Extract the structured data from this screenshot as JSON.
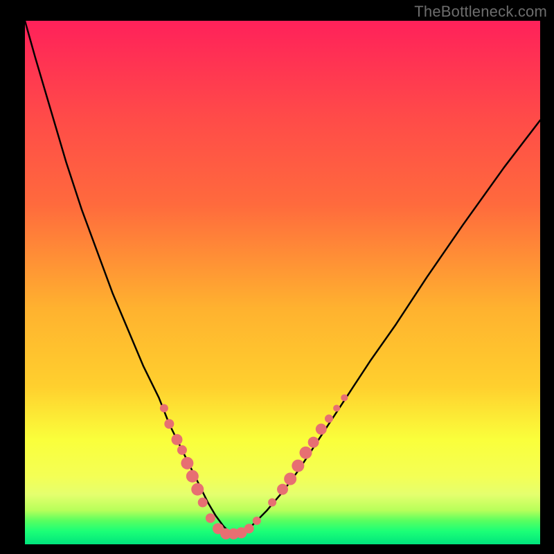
{
  "watermark": "TheBottleneck.com",
  "colors": {
    "background": "#000000",
    "gradient_top": "#ff215a",
    "gradient_upper": "#ff6a3d",
    "gradient_mid": "#ffd02e",
    "gradient_lower": "#faff3b",
    "gradient_band": "#e5ff6e",
    "gradient_bottom1": "#58ff60",
    "gradient_bottom2": "#00e57c",
    "curve": "#000000",
    "marker": "#e76f72",
    "watermark_color": "#6d6d6d"
  },
  "chart_data": {
    "type": "line",
    "title": "",
    "xlabel": "",
    "ylabel": "",
    "xlim": [
      0,
      100
    ],
    "ylim": [
      0,
      100
    ],
    "series": [
      {
        "name": "curve",
        "x": [
          0,
          2,
          5,
          8,
          11,
          14,
          17,
          20,
          23,
          26,
          28,
          30,
          32,
          34,
          35.5,
          37,
          38.5,
          40,
          42,
          44,
          47,
          50,
          53,
          56,
          59,
          63,
          67,
          72,
          78,
          85,
          93,
          100
        ],
        "y": [
          100,
          93,
          83,
          73,
          64,
          56,
          48,
          41,
          34,
          28,
          23,
          19,
          15,
          11,
          8,
          5.5,
          3.5,
          2,
          2,
          3.5,
          6.5,
          10,
          14,
          18.5,
          23,
          29,
          35,
          42,
          51,
          61,
          72,
          81
        ]
      }
    ],
    "markers": {
      "name": "highlighted-points",
      "points": [
        {
          "x": 27,
          "y": 26,
          "r": 6
        },
        {
          "x": 28,
          "y": 23,
          "r": 7
        },
        {
          "x": 29.5,
          "y": 20,
          "r": 8
        },
        {
          "x": 30.5,
          "y": 18,
          "r": 7
        },
        {
          "x": 31.5,
          "y": 15.5,
          "r": 9
        },
        {
          "x": 32.5,
          "y": 13,
          "r": 9
        },
        {
          "x": 33.5,
          "y": 10.5,
          "r": 9
        },
        {
          "x": 34.5,
          "y": 8,
          "r": 7
        },
        {
          "x": 36,
          "y": 5,
          "r": 7
        },
        {
          "x": 37.5,
          "y": 3,
          "r": 8
        },
        {
          "x": 39,
          "y": 2,
          "r": 8
        },
        {
          "x": 40.5,
          "y": 2,
          "r": 8
        },
        {
          "x": 42,
          "y": 2.2,
          "r": 8
        },
        {
          "x": 43.5,
          "y": 3,
          "r": 7
        },
        {
          "x": 45,
          "y": 4.5,
          "r": 6
        },
        {
          "x": 48,
          "y": 8,
          "r": 6
        },
        {
          "x": 50,
          "y": 10.5,
          "r": 8
        },
        {
          "x": 51.5,
          "y": 12.5,
          "r": 9
        },
        {
          "x": 53,
          "y": 15,
          "r": 9
        },
        {
          "x": 54.5,
          "y": 17.5,
          "r": 9
        },
        {
          "x": 56,
          "y": 19.5,
          "r": 8
        },
        {
          "x": 57.5,
          "y": 22,
          "r": 8
        },
        {
          "x": 59,
          "y": 24,
          "r": 6
        },
        {
          "x": 60.5,
          "y": 26,
          "r": 5
        },
        {
          "x": 62,
          "y": 28,
          "r": 5
        }
      ]
    }
  }
}
